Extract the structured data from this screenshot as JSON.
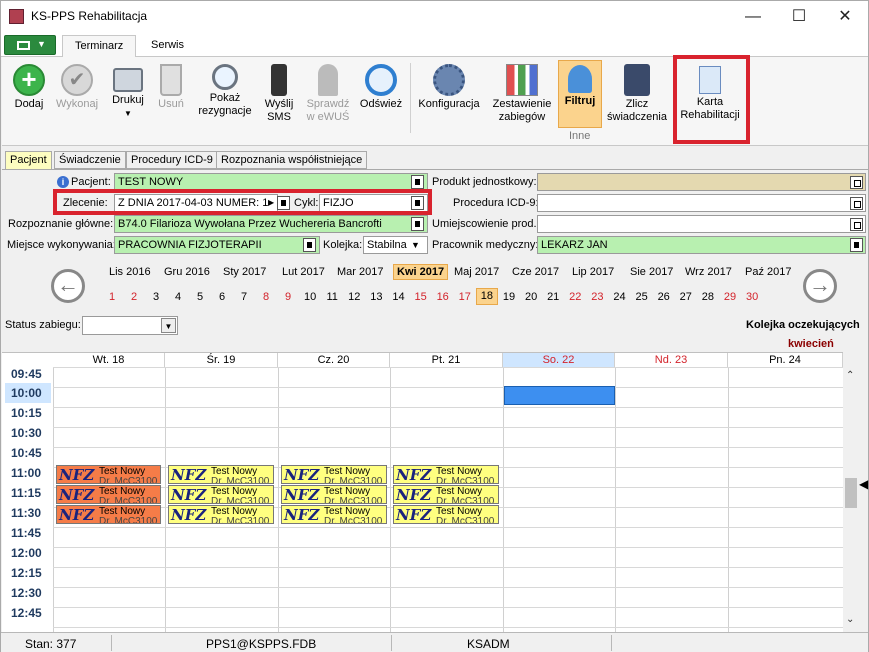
{
  "window": {
    "title": "KS-PPS Rehabilitacja",
    "min": "—",
    "max": "☐",
    "close": "✕"
  },
  "ribbon_tabs": [
    {
      "label": "Terminarz"
    },
    {
      "label": "Serwis"
    }
  ],
  "toolbar": {
    "dodaj": "Dodaj",
    "wykonaj": "Wykonaj",
    "drukuj": "Drukuj",
    "usun": "Usuń",
    "pokaz1": "Pokaż",
    "pokaz2": "rezygnacje",
    "wyslij1": "Wyślij",
    "wyslij2": "SMS",
    "sprawdz1": "Sprawdź",
    "sprawdz2": "w eWUŚ",
    "odswiez": "Odśwież",
    "konfig": "Konfiguracja",
    "zest1": "Zestawienie",
    "zest2": "zabiegów",
    "filtruj": "Filtruj",
    "zlicz1": "Zlicz",
    "zlicz2": "świadczenia",
    "karta1": "Karta",
    "karta2": "Rehabilitacji",
    "group_inne": "Inne"
  },
  "form_tabs": [
    {
      "label": "Pacjent"
    },
    {
      "label": "Świadczenie"
    },
    {
      "label": "Procedury ICD-9"
    },
    {
      "label": "Rozpoznania współistniejące"
    }
  ],
  "form": {
    "pacjent_label": "Pacjent:",
    "pacjent": "TEST NOWY",
    "zlecenie_label": "Zlecenie:",
    "zlecenie": "Z DNIA 2017-04-03 NUMER: 1",
    "cykl_label": "Cykl:",
    "cykl": "FIZJO",
    "rozp_label": "Rozpoznanie główne:",
    "rozp": "B74.0 Filarioza Wywołana Przez Wuchereria Bancrofti",
    "miejsce_label": "Miejsce wykonywania:",
    "miejsce": "PRACOWNIA FIZJOTERAPII",
    "kolejka_label": "Kolejka:",
    "kolejka": "Stabilna",
    "produkt_label": "Produkt jednostkowy:",
    "produkt": "",
    "procedura_label": "Procedura ICD-9:",
    "procedura": "",
    "umiejsc_label": "Umiejscowienie prod.:",
    "umiejsc": "",
    "pracownik_label": "Pracownik medyczny:",
    "pracownik": "LEKARZ JAN"
  },
  "calendar": {
    "months": [
      "Lis 2016",
      "Gru 2016",
      "Sty 2017",
      "Lut 2017",
      "Mar 2017",
      "Kwi 2017",
      "Maj 2017",
      "Cze 2017",
      "Lip 2017",
      "Sie 2017",
      "Wrz 2017",
      "Paź 2017"
    ],
    "selected_month": "Kwi 2017",
    "days": [
      "1",
      "2",
      "3",
      "4",
      "5",
      "6",
      "7",
      "8",
      "9",
      "10",
      "11",
      "12",
      "13",
      "14",
      "15",
      "16",
      "17",
      "18",
      "19",
      "20",
      "21",
      "22",
      "23",
      "24",
      "25",
      "26",
      "27",
      "28",
      "29",
      "30"
    ],
    "selected_day": "18",
    "status_label": "Status zabiegu:",
    "queue_label": "Kolejka oczekujących",
    "month_name": "kwiecień"
  },
  "schedule": {
    "columns": [
      "Wt. 18",
      "Śr. 19",
      "Cz. 20",
      "Pt. 21",
      "So. 22",
      "Nd. 23",
      "Pn. 24"
    ],
    "times": [
      "09:45",
      "10:00",
      "10:15",
      "10:30",
      "10:45",
      "11:00",
      "11:15",
      "11:30",
      "11:45",
      "12:00",
      "12:15",
      "12:30",
      "12:45"
    ],
    "appt_title": "Test Nowy",
    "appt_sub": "Dr. McC3100",
    "nfz": "NFZ"
  },
  "statusbar": {
    "stan": "Stan: 377",
    "db": "PPS1@KSPPS.FDB",
    "user": "KSADM"
  },
  "colors": {
    "accent_red": "#d9232e",
    "green_field": "#b8f0b0",
    "orange_appt": "#f57c48",
    "yellow_appt": "#ffff80"
  }
}
